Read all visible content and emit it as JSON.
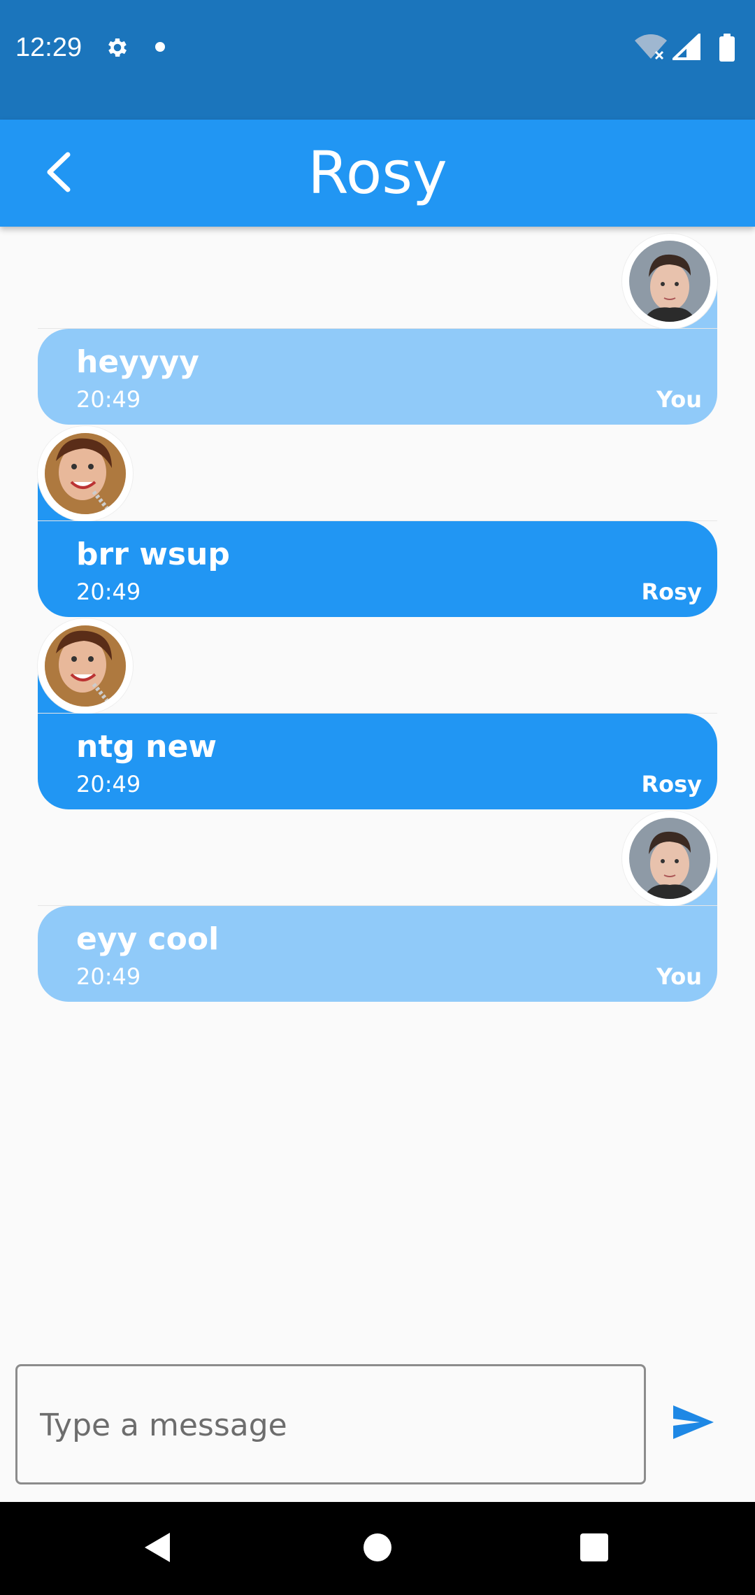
{
  "status_bar": {
    "time": "12:29",
    "icons": [
      "gear-icon",
      "notification-dot-icon",
      "wifi-off-icon",
      "signal-icon",
      "battery-icon"
    ]
  },
  "app_bar": {
    "title": "Rosy",
    "back_icon": "chevron-left-icon"
  },
  "messages": [
    {
      "text": "heyyyy",
      "time": "20:49",
      "author": "You",
      "side": "right",
      "avatar": "male-avatar"
    },
    {
      "text": "brr wsup",
      "time": "20:49",
      "author": "Rosy",
      "side": "left",
      "avatar": "female-avatar"
    },
    {
      "text": "ntg new",
      "time": "20:49",
      "author": "Rosy",
      "side": "left",
      "avatar": "female-avatar"
    },
    {
      "text": "eyy cool",
      "time": "20:49",
      "author": "You",
      "side": "right",
      "avatar": "male-avatar"
    }
  ],
  "composer": {
    "placeholder": "Type a message",
    "value": "",
    "send_icon": "send-icon"
  },
  "nav_bar": {
    "buttons": [
      "back-triangle-icon",
      "home-circle-icon",
      "recents-square-icon"
    ]
  },
  "colors": {
    "status_bar": "#1b75bc",
    "app_bar": "#2196f3",
    "bubble_self": "#90caf9",
    "bubble_other": "#2196f3",
    "background": "#fafafa"
  }
}
